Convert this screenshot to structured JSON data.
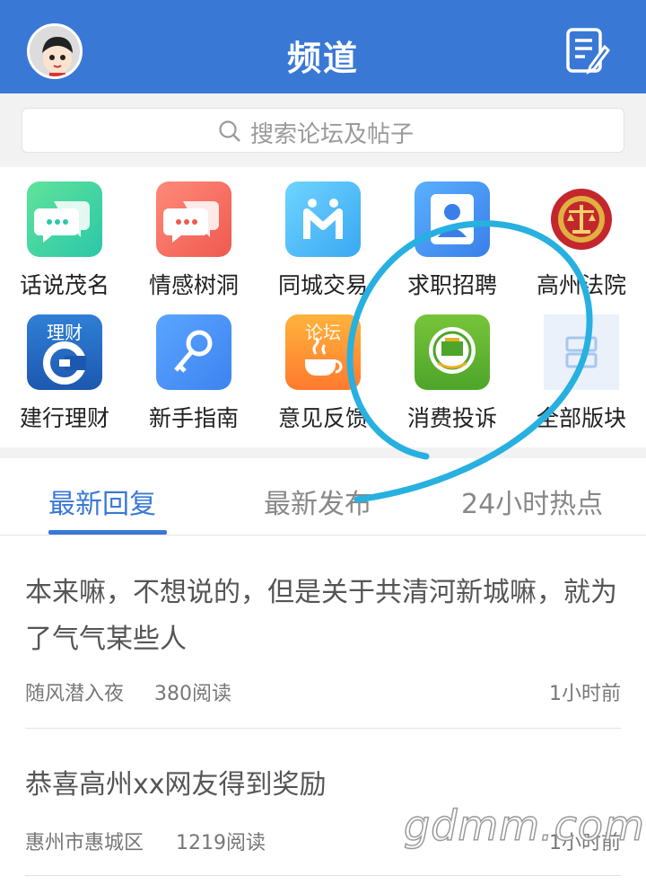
{
  "header": {
    "title": "频道"
  },
  "search": {
    "placeholder": "搜索论坛及帖子"
  },
  "channels": [
    {
      "label": "话说茂名",
      "icon": "chat-bubble-icon"
    },
    {
      "label": "情感树洞",
      "icon": "chat-bubble-icon"
    },
    {
      "label": "同城交易",
      "icon": "m-logo-icon"
    },
    {
      "label": "求职招聘",
      "icon": "person-icon"
    },
    {
      "label": "高州法院",
      "icon": "court-emblem-icon"
    },
    {
      "label": "建行理财",
      "icon": "ccb-logo-icon",
      "badge": "理财"
    },
    {
      "label": "新手指南",
      "icon": "key-icon"
    },
    {
      "label": "意见反馈",
      "icon": "coffee-icon",
      "badge": "论坛"
    },
    {
      "label": "消费投诉",
      "icon": "consumer-emblem-icon"
    },
    {
      "label": "全部版块",
      "icon": "grid-icon"
    }
  ],
  "tabs": [
    {
      "label": "最新回复",
      "active": true
    },
    {
      "label": "最新发布",
      "active": false
    },
    {
      "label": "24小时热点",
      "active": false
    }
  ],
  "posts": [
    {
      "title": "本来嘛，不想说的，但是关于共清河新城嘛，就为了气气某些人",
      "author": "随风潜入夜",
      "reads": "380阅读",
      "time": "1小时前"
    },
    {
      "title": "恭喜高州xx网友得到奖励",
      "author": "惠州市惠城区",
      "reads": "1219阅读",
      "time": "1小时前"
    }
  ],
  "watermark": "gdmm.com",
  "colors": {
    "primary": "#3a78d6",
    "background": "#f2f2f2"
  }
}
